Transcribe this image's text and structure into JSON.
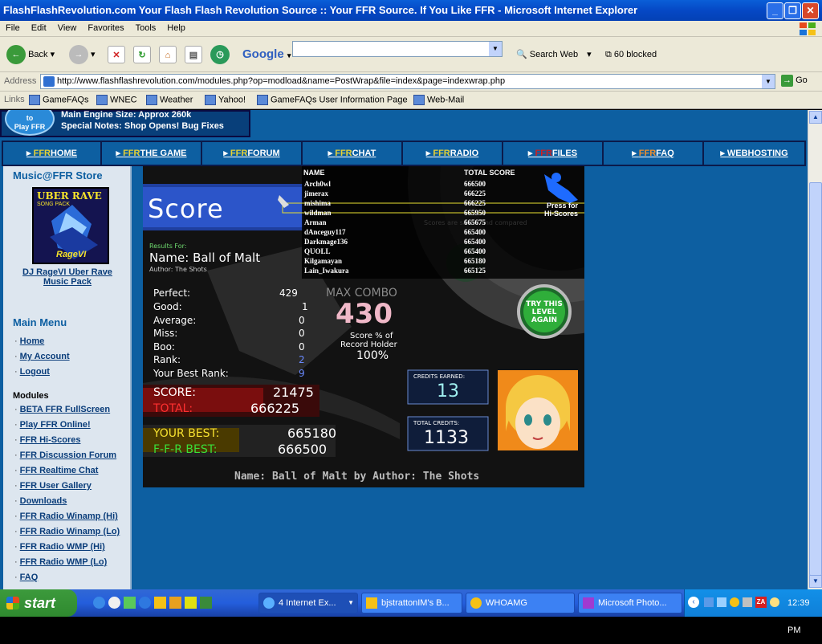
{
  "window": {
    "title": "FlashFlashRevolution.com Your Flash Flash Revolution Source :: Your FFR Source. If You Like FFR - Microsoft Internet Explorer",
    "minimize": "_",
    "maximize": "❐",
    "close": "✕"
  },
  "menu": [
    "File",
    "Edit",
    "View",
    "Favorites",
    "Tools",
    "Help"
  ],
  "toolbar": {
    "back": "Back",
    "google": "Google",
    "search_web": "Search Web",
    "blocked": "60 blocked"
  },
  "address": {
    "label": "Address",
    "url": "http://www.flashflashrevolution.com/modules.php?op=modload&name=PostWrap&file=index&page=indexwrap.php",
    "go": "Go"
  },
  "links": {
    "label": "Links",
    "items": [
      "GameFAQs",
      "WNEC",
      "Weather",
      "Yahoo!",
      "GameFAQs User Information Page",
      "Web-Mail"
    ]
  },
  "banner": {
    "badge_line1": "to",
    "badge_line2": "Play FFR",
    "line1": "Main Engine Size: Approx 260k",
    "line2": "Special Notes: Shop Opens! Bug Fixes"
  },
  "nav": [
    {
      "ffr": "FFR",
      "rest": "HOME"
    },
    {
      "ffr": "FFR",
      "rest": "THE GAME"
    },
    {
      "ffr": "FFR",
      "rest": "FORUM"
    },
    {
      "ffr": "FFR",
      "rest": "CHAT"
    },
    {
      "ffr": "FFR",
      "rest": "RADIO"
    },
    {
      "ffr": "FFR",
      "rest": "FILES"
    },
    {
      "ffr": "FFR",
      "rest": "FAQ"
    },
    {
      "ffr": "",
      "rest": "WEBHOSTING"
    }
  ],
  "sidebar": {
    "store_title": "Music@FFR Store",
    "album_top": "UBER RAVE",
    "album_sub": "SONG PACK",
    "album_sig": "RageVI",
    "album_label_line1": "DJ RageVI Uber Rave",
    "album_label_line2": "Music Pack",
    "main_menu_title": "Main Menu",
    "main_menu": [
      "Home",
      "My Account",
      "Logout"
    ],
    "modules_title": "Modules",
    "modules": [
      "BETA FFR FullScreen",
      "Play FFR Online!",
      "FFR Hi-Scores",
      "FFR Discussion Forum",
      "FFR Realtime Chat",
      "FFR User Gallery",
      "Downloads",
      "FFR Radio Winamp (Hi)",
      "FFR Radio Winamp (Lo)",
      "FFR Radio WMP (Hi)",
      "FFR Radio WMP (Lo)",
      "FAQ"
    ]
  },
  "game": {
    "score_title": "Score",
    "results_for": "Results For:",
    "name_line": "Name: Ball of Malt",
    "author_line": "Author: The Shots",
    "stats": [
      {
        "label": "Perfect:",
        "value": "429"
      },
      {
        "label": "Good:",
        "value": "1"
      },
      {
        "label": "Average:",
        "value": "0"
      },
      {
        "label": "Miss:",
        "value": "0"
      },
      {
        "label": "Boo:",
        "value": "0"
      },
      {
        "label": "Rank:",
        "value": "2"
      },
      {
        "label": "Your Best Rank:",
        "value": "9"
      }
    ],
    "max_combo_label": "MAX COMBO",
    "max_combo": "430",
    "record_pct_line1": "Score % of",
    "record_pct_line2": "Record Holder",
    "record_pct": "100%",
    "score_label": "SCORE:",
    "score": "21475",
    "total_label": "TOTAL:",
    "total": "666225",
    "your_best_label": "YOUR BEST:",
    "your_best": "665180",
    "ffr_best_label": "F-F-R BEST:",
    "ffr_best": "666500",
    "credits_earned_label": "CREDITS EARNED:",
    "credits_earned": "13",
    "total_credits_label": "TOTAL CREDITS:",
    "total_credits": "1133",
    "try_again": "TRY THIS LEVEL AGAIN",
    "press_for_line1": "Press for",
    "press_for_line2": "Hi-Scores",
    "scores_faded": "Scores are saved and compared",
    "footer": "Name: Ball of Malt by Author: The Shots",
    "hiscore_header_name": "NAME",
    "hiscore_header_score": "TOTAL SCORE",
    "hiscores": [
      {
        "name": "Arch0wl",
        "score": "666500"
      },
      {
        "name": "jimerax",
        "score": "666225"
      },
      {
        "name": "mishima",
        "score": "666225"
      },
      {
        "name": "wildman",
        "score": "665950"
      },
      {
        "name": "Arman",
        "score": "665675"
      },
      {
        "name": "dAnceguy117",
        "score": "665400"
      },
      {
        "name": "Darkmage136",
        "score": "665400"
      },
      {
        "name": "QUOLL",
        "score": "665400"
      },
      {
        "name": "Kilgamayan",
        "score": "665180"
      },
      {
        "name": "Lain_Iwakura",
        "score": "665125"
      }
    ]
  },
  "taskbar": {
    "start": "start",
    "tasks": [
      "4 Internet Ex...",
      "bjstrattonIM's B...",
      "WHOAMG",
      "Microsoft Photo..."
    ],
    "clock": "12:39 PM"
  }
}
